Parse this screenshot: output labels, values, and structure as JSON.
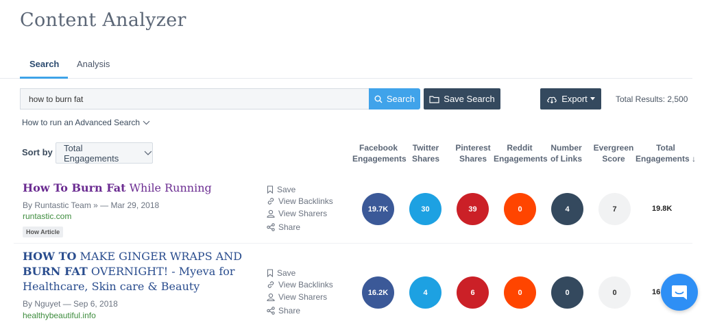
{
  "app": {
    "title": "Content Analyzer"
  },
  "tabs": [
    {
      "label": "Search",
      "active": true
    },
    {
      "label": "Analysis",
      "active": false
    }
  ],
  "search": {
    "value": "how to burn fat",
    "search_label": "Search",
    "save_label": "Save Search",
    "export_label": "Export",
    "total_results": "Total Results: 2,500",
    "advanced_link": "How to run an Advanced Search"
  },
  "sort": {
    "label": "Sort by",
    "selected": "Total Engagements"
  },
  "columns": [
    {
      "line1": "Facebook",
      "line2": "Engagements"
    },
    {
      "line1": "Twitter",
      "line2": "Shares"
    },
    {
      "line1": "Pinterest",
      "line2": "Shares"
    },
    {
      "line1": "Reddit",
      "line2": "Engagements"
    },
    {
      "line1": "Number",
      "line2": "of Links"
    },
    {
      "line1": "Evergreen",
      "line2": "Score"
    },
    {
      "line1": "Total",
      "line2": "Engagements ↓"
    }
  ],
  "actions": {
    "save": "Save",
    "backlinks": "View Backlinks",
    "sharers": "View Sharers",
    "share": "Share"
  },
  "results": [
    {
      "title_bold": "How To Burn Fat",
      "title_rest": " While Running",
      "meta": "By Runtastic Team » — Mar 29, 2018",
      "domain": "runtastic.com",
      "tag": "How Article",
      "metrics": [
        "19.7K",
        "30",
        "39",
        "0",
        "4",
        "7"
      ],
      "total": "19.8K"
    },
    {
      "title_line1_bold": "HOW TO",
      "title_line1_rest": " MAKE GINGER WRAPS AND",
      "title_line2_bold": "BURN FAT",
      "title_line2_rest": " OVERNIGHT! - Myeva for",
      "title_line3": "Healthcare, Skin care & Beauty",
      "meta": "By Nguyet — Sep 6, 2018",
      "domain": "healthybeautiful.info",
      "metrics": [
        "16.2K",
        "4",
        "6",
        "0",
        "0",
        "0"
      ],
      "total": "16"
    }
  ],
  "colors": {
    "facebook": "#3b5998",
    "twitter": "#1da1e2",
    "pinterest": "#cb2027",
    "reddit": "#ff4500",
    "links": "#34495e",
    "accent": "#40a3ea"
  }
}
